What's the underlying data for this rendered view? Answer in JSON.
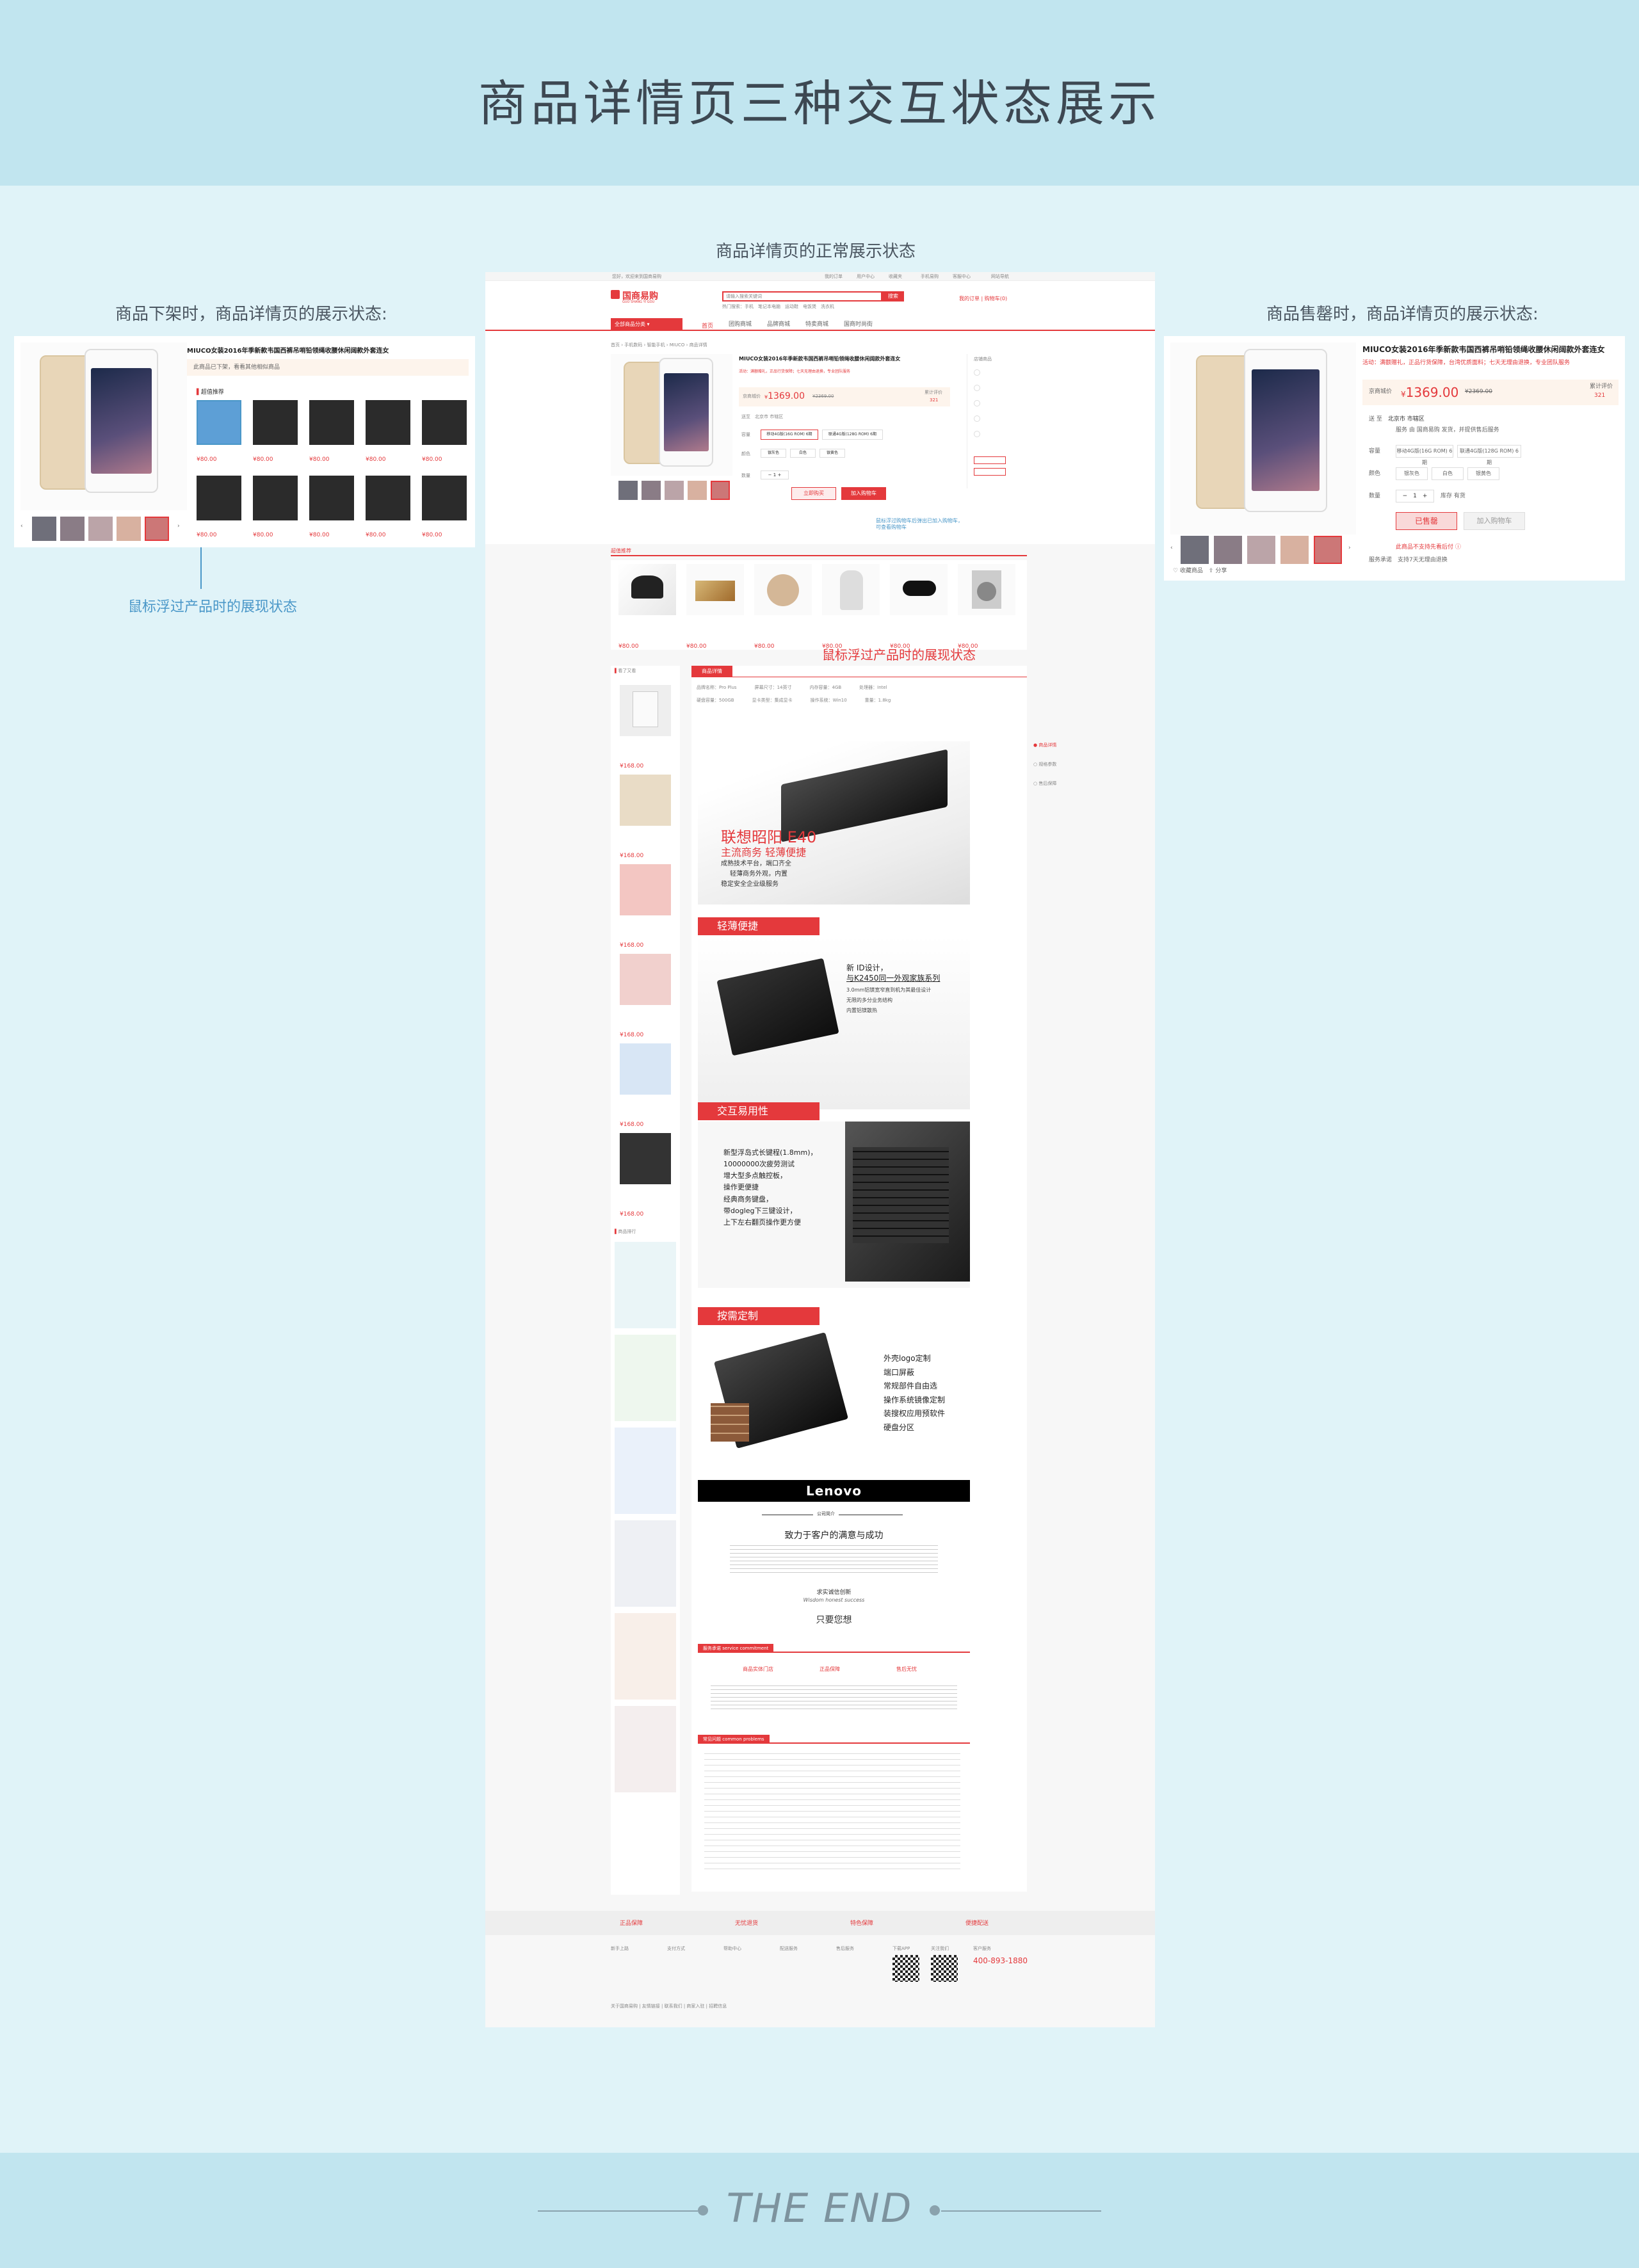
{
  "header": {
    "title": "商品详情页三种交互状态展示"
  },
  "captions": {
    "center": "商品详情页的正常展示状态",
    "left": "商品下架时，商品详情页的展示状态:",
    "right": "商品售罄时，商品详情页的展示状态:",
    "hover_left": "鼠标浮过产品时的展现状态",
    "hover_center": "鼠标浮过产品时的展现状态"
  },
  "footer": {
    "end": "THE END"
  },
  "product": {
    "title": "MIUCO女装2016年季新款韦国西裤吊哨铅领绳收腰休闲阔款外套连女",
    "price_symbol": "¥",
    "price": "1369.00",
    "orig_price": "¥2369.00",
    "price_label": "京商城价",
    "sold_label": "累计评价",
    "sold_count": "321",
    "delivered": "送货",
    "capacity": "容量",
    "color": "颜色",
    "qty_label": "数量",
    "qty": "1",
    "stock": "库存 有货",
    "btn_buy": "立即购买",
    "btn_cart": "加入购物车",
    "btn_soldout": "已售罄",
    "btn_cart2": "加入购物车",
    "offline_notice": "此商品已下架，看看其他相似商品",
    "spec_options": [
      "移动4G版(16G ROM) 6期",
      "联通4G版(128G ROM) 6期"
    ],
    "colors": [
      "银灰色",
      "白色",
      "银黄色"
    ],
    "guarantee": "服务 由 国商易购 发货，并提供售后服务",
    "fav": "收藏商品",
    "share": "分享"
  },
  "store": {
    "logo": "国商易购",
    "logo_sub": "GUO SHANG YI GOU",
    "search_placeholder": "请输入搜索关键词",
    "search_btn": "搜索",
    "cart": "购物车",
    "my": "我的订单",
    "nav": [
      "全部商品分类",
      "首页",
      "团购商城",
      "品牌商城",
      "特卖商城",
      "国商时尚街"
    ],
    "topbar": [
      "您好，欢迎来到国商易购",
      "请登录",
      "免费注册",
      "我的订单",
      "用户中心",
      "收藏夹",
      "手机易购",
      "客服中心",
      "网站导航"
    ]
  },
  "recommend": {
    "title": "超值推荐",
    "prices": [
      "¥80.00",
      "¥80.00",
      "¥80.00",
      "¥80.00",
      "¥80.00",
      "¥80.00"
    ]
  },
  "detail_tabs": [
    "商品详情",
    "规格参数",
    "售后保障"
  ],
  "promo": {
    "title": "联想昭阳 E40",
    "sub1": "主流商务 轻薄便捷",
    "sub2": "成熟技术平台，端口齐全",
    "sub3": "轻薄商务外观，内置",
    "sub4": "稳定安全企业级服务",
    "sec1": "轻薄便捷",
    "sec2": "交互易用性",
    "sec3": "按需定制",
    "s1_a": "新 ID设计，",
    "s1_b": "与K2450同一外观家族系列",
    "s1_c": "3.0mm铝镁宽窄直到机为其最佳设计",
    "s1_d": "无限的多分业务结构",
    "s1_e": "内置铝镁散热",
    "s2": [
      "新型浮岛式长键程(1.8mm)，",
      "10000000次疲劳测试",
      "增大型多点触控板，",
      "操作更便捷",
      "经典商务键盘，",
      "带dogleg下三键设计，",
      "上下左右翻页操作更方便"
    ],
    "s3": [
      "外壳logo定制",
      "端口屏蔽",
      "常规部件自由选",
      "操作系统镜像定制",
      "装搜权应用预软件",
      "硬盘分区"
    ],
    "brand": "Lenovo",
    "promise_title": "公司简介",
    "promise_h": "致力于客户的满意与成功",
    "honest": "求实诚信创新",
    "honest_en": "Wisdom honest success",
    "only": "只要您想",
    "svc_title": "服务承诺",
    "svc_en": "service commitment",
    "svc": [
      "商品实体门店",
      "正品保障",
      "售后无忧"
    ],
    "faq_title": "常见问题",
    "faq_en": "common problems"
  },
  "left_col": {
    "title": "看了又看",
    "prices": [
      "¥168.00",
      "¥168.00",
      "¥168.00",
      "¥168.00",
      "¥168.00",
      "¥168.00"
    ],
    "ranking": "商品排行"
  },
  "page_footer": {
    "guarantees": [
      "正品保障",
      "无忧退货",
      "特色保障",
      "便捷配送"
    ],
    "phone": "400-893-1880",
    "cols": [
      "新手上路",
      "支付方式",
      "帮助中心",
      "配送服务",
      "售后服务",
      "下载APP",
      "关注我们",
      "客户服务"
    ]
  }
}
